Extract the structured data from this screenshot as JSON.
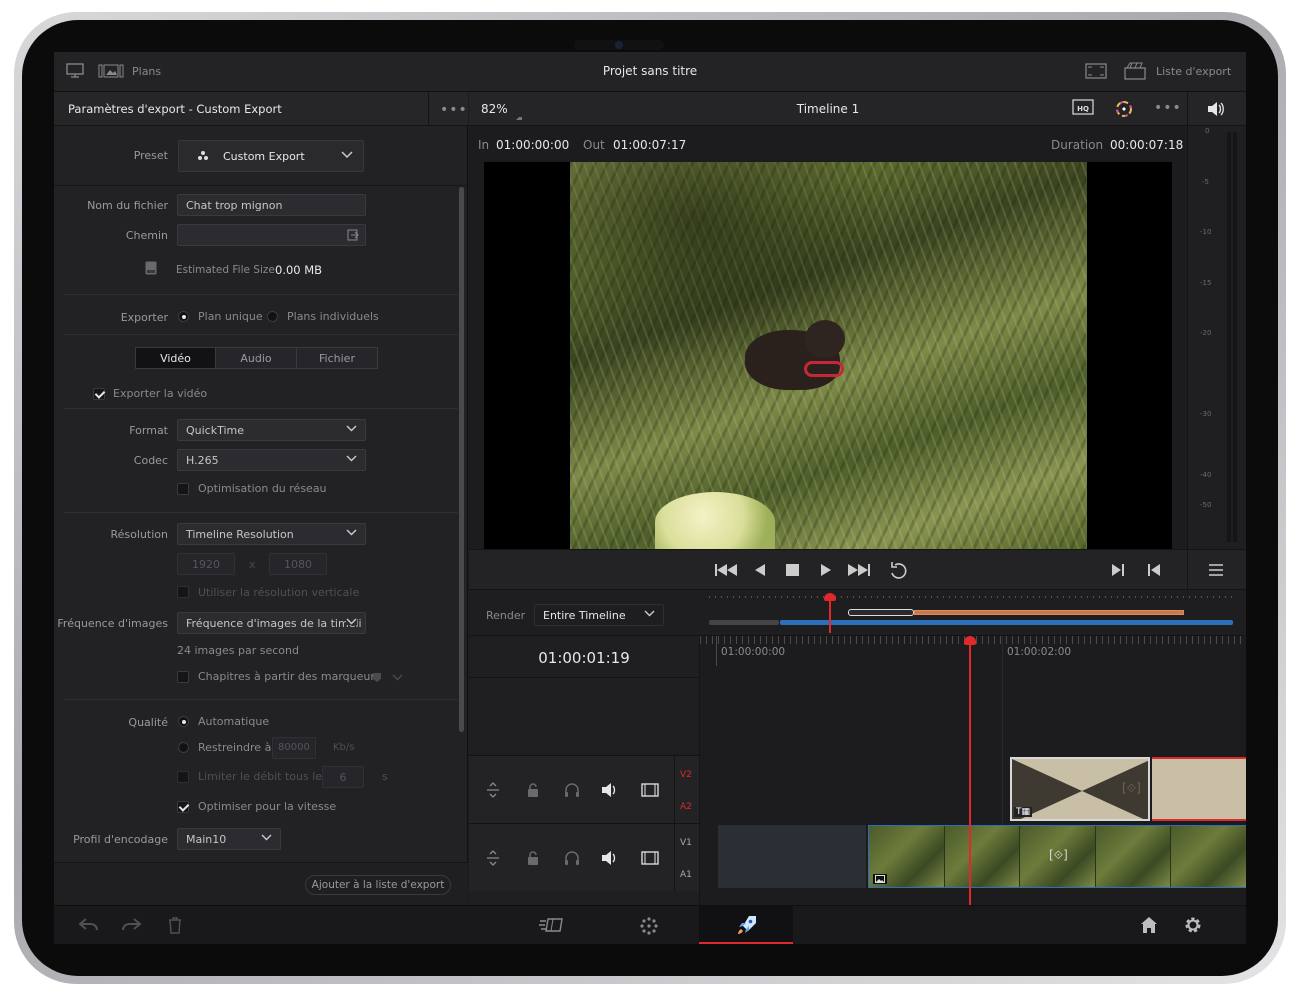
{
  "topbar": {
    "title": "Projet sans titre",
    "left_label": "Plans",
    "right_label": "Liste d'export"
  },
  "export_panel": {
    "header": "Paramètres d'export - Custom Export",
    "preset_label": "Preset",
    "preset_value": "Custom Export",
    "filename_label": "Nom du fichier",
    "filename_value": "Chat trop mignon",
    "path_label": "Chemin",
    "path_value": "",
    "estimated_label": "Estimated File Size",
    "estimated_value": "0.00 MB",
    "export_label": "Exporter",
    "export_opt_single": "Plan unique",
    "export_opt_individual": "Plans individuels",
    "tabs": [
      "Vidéo",
      "Audio",
      "Fichier"
    ],
    "export_video_label": "Exporter la vidéo",
    "format_label": "Format",
    "format_value": "QuickTime",
    "codec_label": "Codec",
    "codec_value": "H.265",
    "network_opt_label": "Optimisation du réseau",
    "resolution_label": "Résolution",
    "resolution_value": "Timeline Resolution",
    "res_width": "1920",
    "res_x": "x",
    "res_height": "1080",
    "vertical_res_label": "Utiliser la résolution verticale",
    "framerate_label": "Fréquence d'images",
    "framerate_value": "Fréquence d'images de la timeli",
    "framerate_note": "24 images par second",
    "chapters_label": "Chapitres à partir des marqueurs",
    "quality_label": "Qualité",
    "quality_auto": "Automatique",
    "quality_restrict": "Restreindre à",
    "quality_restrict_value": "80000",
    "quality_restrict_unit": "Kb/s",
    "keyframes_label": "Limiter le débit tous les",
    "keyframes_value": "6",
    "keyframes_unit": "s",
    "optimize_speed_label": "Optimiser pour la vitesse",
    "encoding_profile_label": "Profil d'encodage",
    "encoding_profile_value": "Main10",
    "add_button": "Ajouter à la liste d'export"
  },
  "viewer": {
    "zoom": "82%",
    "timeline_name": "Timeline 1",
    "in_label": "In",
    "in_value": "01:00:00:00",
    "out_label": "Out",
    "out_value": "01:00:07:17",
    "duration_label": "Duration",
    "duration_value": "00:00:07:18"
  },
  "audio_meter": {
    "ticks": [
      "0",
      "-5",
      "-10",
      "-15",
      "-20",
      "-30",
      "-40",
      "-50"
    ]
  },
  "render": {
    "label": "Render",
    "value": "Entire Timeline"
  },
  "timeline": {
    "current_tc": "01:00:01:19",
    "ruler": [
      "01:00:00:00",
      "01:00:02:00"
    ],
    "tracks": [
      "V2",
      "A2",
      "V1",
      "A1"
    ]
  },
  "colors": {
    "accent_red": "#e0292b",
    "accent_blue": "#2d6fb8",
    "panel": "#222225"
  }
}
